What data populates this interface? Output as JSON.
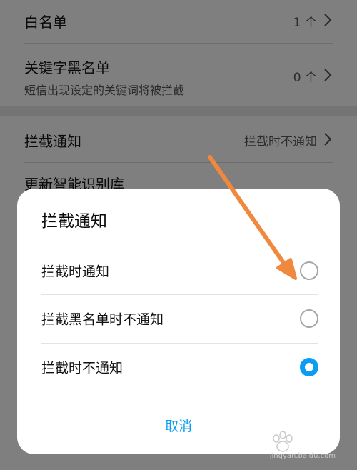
{
  "settings": {
    "whitelist": {
      "title": "白名单",
      "value": "1 个"
    },
    "keyword_blacklist": {
      "title": "关键字黑名单",
      "subtitle": "短信出现设定的关键词将被拦截",
      "value": "0 个"
    },
    "block_notification": {
      "title": "拦截通知",
      "value": "拦截时不通知"
    },
    "update_library": {
      "title": "更新智能识别库"
    }
  },
  "dialog": {
    "title": "拦截通知",
    "options": [
      {
        "label": "拦截时通知",
        "checked": false
      },
      {
        "label": "拦截黑名单时不通知",
        "checked": false
      },
      {
        "label": "拦截时不通知",
        "checked": true
      }
    ],
    "cancel_label": "取消"
  },
  "watermark": {
    "text": "jingyan.baidu.com"
  },
  "colors": {
    "accent": "#0a9df3",
    "annotation_arrow": "#f0883e",
    "dim_overlay": "#7f7f7f"
  },
  "icons": {
    "chevron": "chevron-right-icon",
    "radio": "radio-button-icon",
    "watermark_logo": "baidu-paw-icon"
  }
}
